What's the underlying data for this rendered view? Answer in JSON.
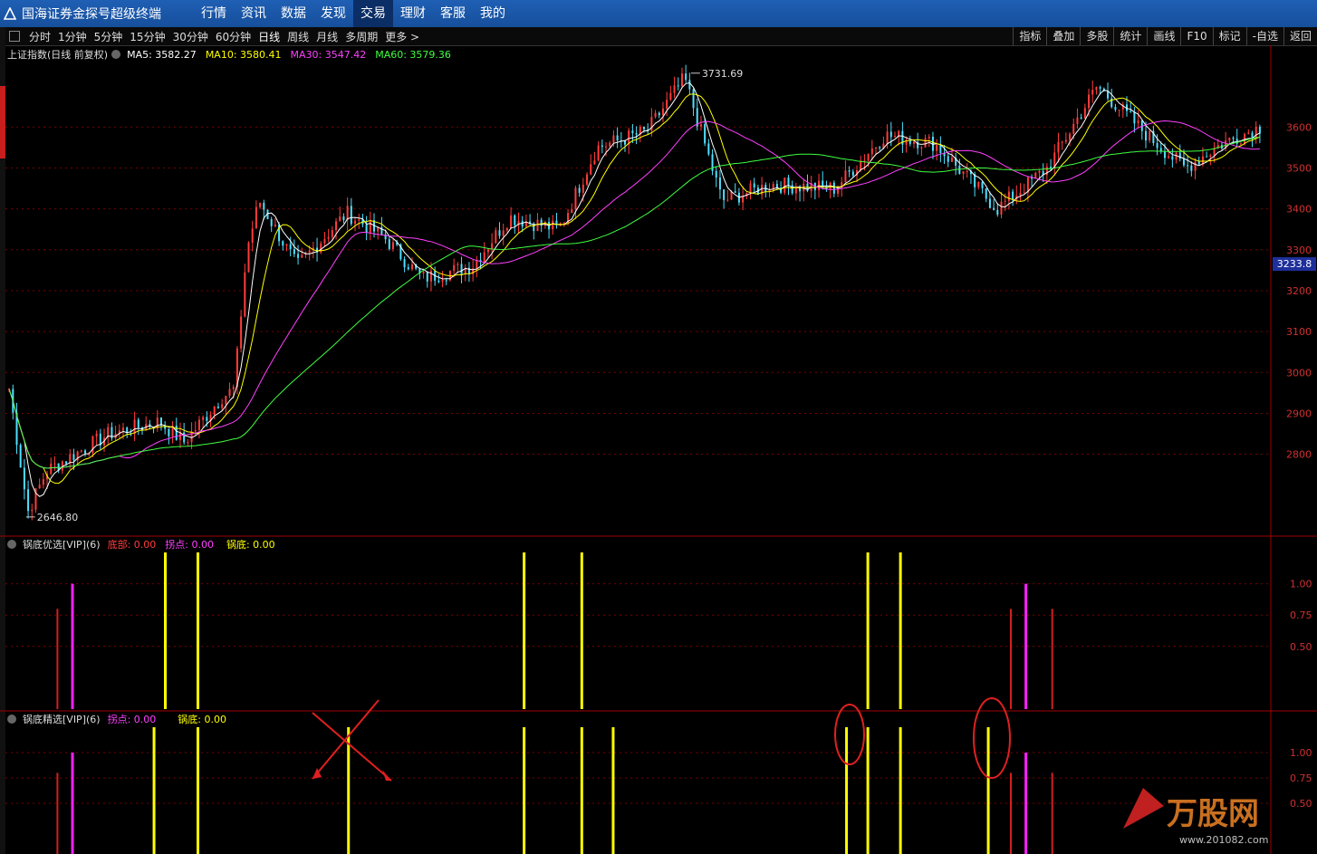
{
  "app": {
    "title": "国海证券金探号超级终端"
  },
  "nav": [
    "行情",
    "资讯",
    "数据",
    "发现",
    "交易",
    "理财",
    "客服",
    "我的"
  ],
  "nav_active_index": 4,
  "periods": [
    "分时",
    "1分钟",
    "5分钟",
    "15分钟",
    "30分钟",
    "60分钟",
    "日线",
    "周线",
    "月线",
    "多周期",
    "更多 >"
  ],
  "period_active_index": 6,
  "tools": [
    "指标",
    "叠加",
    "多股",
    "统计",
    "画线",
    "F10",
    "标记",
    "-自选",
    "返回"
  ],
  "main_panel": {
    "title": "上证指数(日线 前复权)",
    "ma5": "MA5: 3582.27",
    "ma10": "MA10: 3580.41",
    "ma30": "MA30: 3547.42",
    "ma60": "MA60: 3579.36",
    "high_label": "3731.69",
    "low_label": "2646.80",
    "current_price": "3233.8",
    "y_ticks": [
      "3600",
      "3500",
      "3400",
      "3300",
      "3200",
      "3100",
      "3000",
      "2900",
      "2800"
    ]
  },
  "panel2": {
    "title": "锅底优选[VIP](6)",
    "dibu": "底部: 0.00",
    "guaidian": "拐点: 0.00",
    "guodi": "锅底: 0.00",
    "y_ticks": [
      "1.00",
      "0.75",
      "0.50"
    ]
  },
  "panel3": {
    "title": "锅底精选[VIP](6)",
    "guaidian": "拐点: 0.00",
    "guodi": "锅底: 0.00",
    "y_ticks": [
      "1.00",
      "0.75",
      "0.50"
    ]
  },
  "watermark": {
    "brand": "万股网",
    "url": "www.201082.com"
  },
  "colors": {
    "up": "#ff3c3c",
    "down": "#50e0ff",
    "ma5": "#ffffff",
    "ma10": "#ffff00",
    "ma30": "#ff40ff",
    "ma60": "#40ff40",
    "signal_yellow": "#ffff00",
    "signal_magenta": "#ff20ff",
    "signal_red": "#d02020",
    "grid": "#7a0000"
  },
  "chart_data": [
    {
      "type": "candlestick",
      "title": "上证指数(日线 前复权)",
      "ylim": [
        2600,
        3760
      ],
      "y_ticks": [
        2800,
        2900,
        3000,
        3100,
        3200,
        3300,
        3400,
        3500,
        3600
      ],
      "anchors": [
        {
          "t": 0,
          "v": 2960
        },
        {
          "t": 0.015,
          "v": 2660
        },
        {
          "t": 0.03,
          "v": 2760
        },
        {
          "t": 0.08,
          "v": 2850
        },
        {
          "t": 0.12,
          "v": 2880
        },
        {
          "t": 0.14,
          "v": 2830
        },
        {
          "t": 0.18,
          "v": 2960
        },
        {
          "t": 0.17,
          "v": 2940
        },
        {
          "t": 0.19,
          "v": 3300
        },
        {
          "t": 0.2,
          "v": 3420
        },
        {
          "t": 0.23,
          "v": 3260
        },
        {
          "t": 0.27,
          "v": 3390
        },
        {
          "t": 0.3,
          "v": 3330
        },
        {
          "t": 0.33,
          "v": 3230
        },
        {
          "t": 0.37,
          "v": 3260
        },
        {
          "t": 0.4,
          "v": 3380
        },
        {
          "t": 0.44,
          "v": 3350
        },
        {
          "t": 0.47,
          "v": 3550
        },
        {
          "t": 0.51,
          "v": 3590
        },
        {
          "t": 0.54,
          "v": 3720
        },
        {
          "t": 0.57,
          "v": 3420
        },
        {
          "t": 0.61,
          "v": 3460
        },
        {
          "t": 0.66,
          "v": 3450
        },
        {
          "t": 0.7,
          "v": 3580
        },
        {
          "t": 0.74,
          "v": 3560
        },
        {
          "t": 0.79,
          "v": 3400
        },
        {
          "t": 0.83,
          "v": 3500
        },
        {
          "t": 0.87,
          "v": 3700
        },
        {
          "t": 0.91,
          "v": 3580
        },
        {
          "t": 0.94,
          "v": 3500
        },
        {
          "t": 0.97,
          "v": 3560
        },
        {
          "t": 1,
          "v": 3600
        }
      ],
      "high": 3731.69,
      "low": 2646.8,
      "current": 3233.8,
      "ma": {
        "MA5": 3582.27,
        "MA10": 3580.41,
        "MA30": 3547.42,
        "MA60": 3579.36
      }
    },
    {
      "type": "bar",
      "title": "锅底优选[VIP](6)",
      "ylim": [
        0,
        1.25
      ],
      "y_ticks": [
        0.5,
        0.75,
        1.0
      ],
      "series": [
        {
          "name": "底部",
          "color": "#d02020",
          "t": [
            0.04,
            0.8,
            0.833
          ],
          "values": [
            0.8,
            0.8,
            0.8
          ]
        },
        {
          "name": "拐点",
          "color": "#ff20ff",
          "t": [
            0.052,
            0.812
          ],
          "values": [
            1.0,
            1.0
          ]
        },
        {
          "name": "锅底",
          "color": "#ffff00",
          "t": [
            0.126,
            0.152,
            0.412,
            0.458,
            0.686,
            0.712
          ],
          "values": [
            1.3,
            1.3,
            1.3,
            1.3,
            1.3,
            1.3
          ]
        }
      ]
    },
    {
      "type": "bar",
      "title": "锅底精选[VIP](6)",
      "ylim": [
        0,
        1.25
      ],
      "y_ticks": [
        0.5,
        0.75,
        1.0
      ],
      "series": [
        {
          "name": "底部",
          "color": "#d02020",
          "t": [
            0.04,
            0.8,
            0.833
          ],
          "values": [
            0.8,
            0.8,
            0.8
          ]
        },
        {
          "name": "拐点",
          "color": "#ff20ff",
          "t": [
            0.052,
            0.812
          ],
          "values": [
            1.0,
            1.0
          ]
        },
        {
          "name": "锅底",
          "color": "#ffff00",
          "t": [
            0.117,
            0.152,
            0.272,
            0.412,
            0.458,
            0.483,
            0.669,
            0.686,
            0.712,
            0.782
          ],
          "values": [
            1.3,
            1.3,
            1.3,
            1.3,
            1.3,
            1.3,
            1.3,
            1.3,
            1.3,
            1.3
          ]
        }
      ]
    }
  ]
}
